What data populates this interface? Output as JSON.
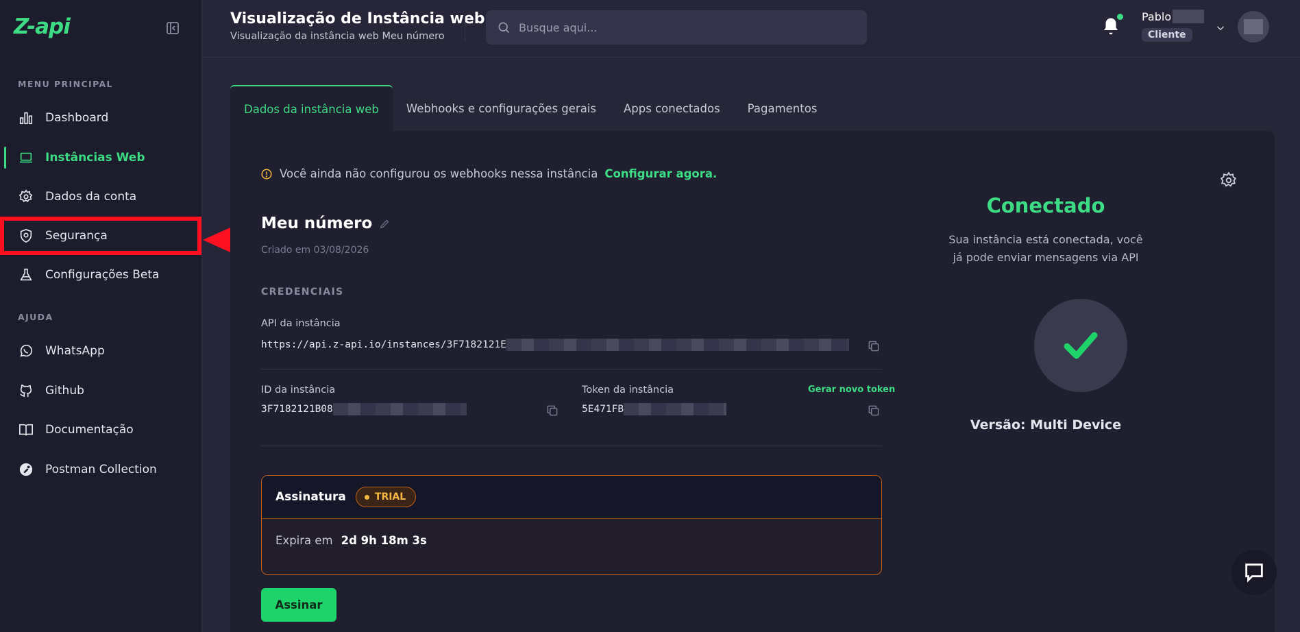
{
  "app": {
    "logo_text": "Z-api",
    "accent_color": "#3ddc84"
  },
  "sidebar": {
    "section_main": "MENU PRINCIPAL",
    "section_help": "AJUDA",
    "items": [
      {
        "label": "Dashboard",
        "icon": "bar-chart-icon"
      },
      {
        "label": "Instâncias Web",
        "icon": "laptop-icon",
        "active": true
      },
      {
        "label": "Dados da conta",
        "icon": "gear-icon"
      },
      {
        "label": "Segurança",
        "icon": "shield-icon",
        "highlighted": true
      },
      {
        "label": "Configurações Beta",
        "icon": "flask-icon"
      }
    ],
    "help_items": [
      {
        "label": "WhatsApp",
        "icon": "whatsapp-icon"
      },
      {
        "label": "Github",
        "icon": "github-icon"
      },
      {
        "label": "Documentação",
        "icon": "book-icon"
      },
      {
        "label": "Postman Collection",
        "icon": "postman-icon"
      }
    ]
  },
  "header": {
    "title": "Visualização de Instância web",
    "subtitle": "Visualização da instância web Meu número",
    "search_placeholder": "Busque aqui...",
    "user_name": "Pablo",
    "user_role": "Cliente"
  },
  "tabs": [
    {
      "label": "Dados da instância web",
      "active": true
    },
    {
      "label": "Webhooks e configurações gerais"
    },
    {
      "label": "Apps conectados"
    },
    {
      "label": "Pagamentos"
    }
  ],
  "main": {
    "warning_text": "Você ainda não configurou os webhooks nessa instância",
    "warning_link": "Configurar agora.",
    "instance_name": "Meu número",
    "created_at": "Criado em 03/08/2026",
    "credentials_label": "CREDENCIAIS",
    "api_label": "API da instância",
    "api_value": "https://api.z-api.io/instances/3F7182121E",
    "id_label": "ID da instância",
    "id_value": "3F7182121B08",
    "token_label": "Token da instância",
    "token_value": "5E471FB",
    "generate_token": "Gerar novo token",
    "subscription_label": "Assinatura",
    "trial_badge": "TRIAL",
    "expires_label": "Expira em",
    "expires_value": "2d 9h 18m 3s",
    "subscribe_button": "Assinar"
  },
  "status": {
    "title": "Conectado",
    "description": "Sua instância está conectada, você já pode enviar mensagens via API",
    "version": "Versão: Multi Device"
  }
}
